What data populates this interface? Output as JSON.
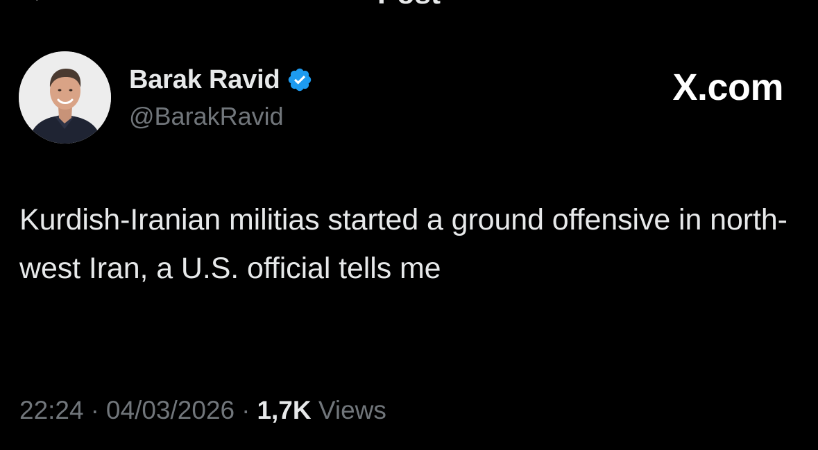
{
  "header": {
    "title": "Post",
    "back_icon": "arrow-left-icon"
  },
  "author": {
    "name": "Barak Ravid",
    "handle": "@BarakRavid",
    "verified_icon": "verified-badge-icon",
    "verified_color": "#1d9bf0"
  },
  "brand": {
    "label": "X.com"
  },
  "post": {
    "text": "Kurdish-Iranian militias started a ground offensive in north-west Iran, a U.S. official tells me"
  },
  "meta": {
    "time": "22:24",
    "separator": "·",
    "date": "04/03/2026",
    "views_count": "1,7K",
    "views_label": "Views"
  },
  "colors": {
    "background": "#000000",
    "primary_text": "#e7e9ea",
    "secondary_text": "#71767b",
    "accent": "#1d9bf0"
  }
}
